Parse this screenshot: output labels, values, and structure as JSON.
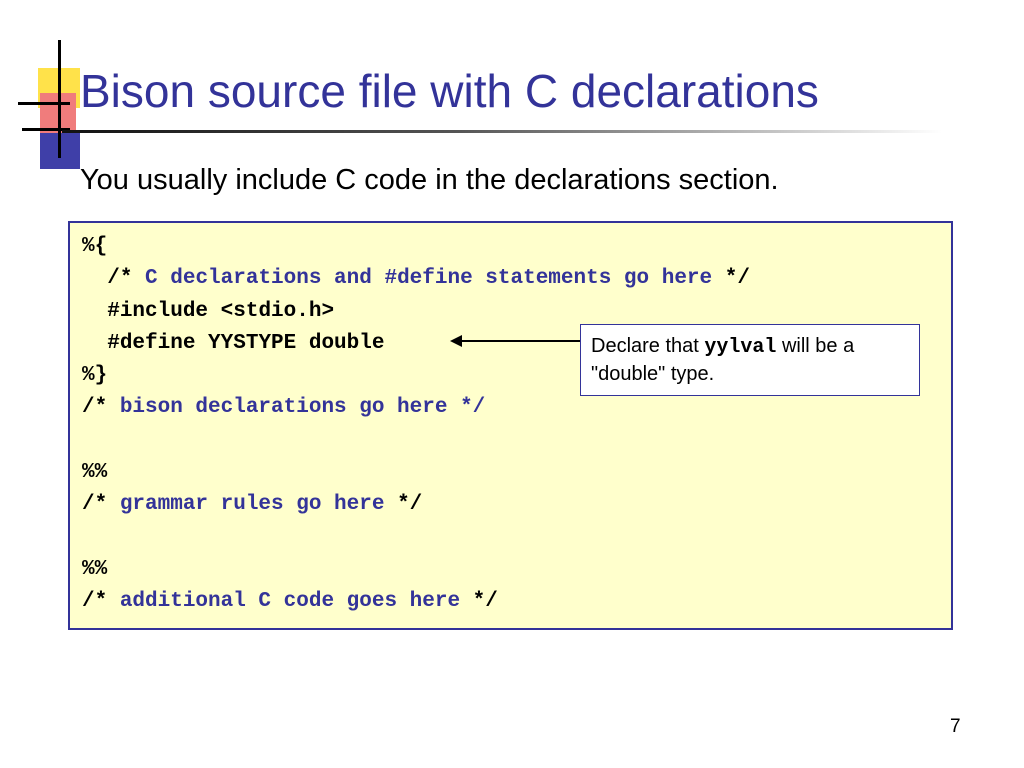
{
  "slide": {
    "title": "Bison source file with C declarations",
    "subtitle": "You usually include C code in the declarations section.",
    "page_number": "7"
  },
  "code": {
    "lines": [
      {
        "indent": "",
        "pre": "%{",
        "comment": "",
        "post": ""
      },
      {
        "indent": "  ",
        "pre": "/* ",
        "comment": "C declarations and #define statements go here ",
        "post": "*/"
      },
      {
        "indent": "  ",
        "pre": "#include <stdio.h>",
        "comment": "",
        "post": ""
      },
      {
        "indent": "  ",
        "pre": "#define YYSTYPE double",
        "comment": "",
        "post": ""
      },
      {
        "indent": "",
        "pre": "%}",
        "comment": "",
        "post": ""
      },
      {
        "indent": "",
        "pre": "/* ",
        "comment": "bison declarations go here */",
        "post": ""
      },
      {
        "indent": "",
        "pre": "",
        "comment": "",
        "post": ""
      },
      {
        "indent": "",
        "pre": "%%",
        "comment": "",
        "post": ""
      },
      {
        "indent": "",
        "pre": "/* ",
        "comment": "grammar rules go here ",
        "post": "*/"
      },
      {
        "indent": "",
        "pre": "",
        "comment": "",
        "post": ""
      },
      {
        "indent": "",
        "pre": "%%",
        "comment": "",
        "post": ""
      },
      {
        "indent": "",
        "pre": "/* ",
        "comment": "additional C code goes here ",
        "post": "*/"
      }
    ]
  },
  "callout": {
    "text_before": "Declare that ",
    "code": "yylval",
    "text_after": " will be a \"double\" type."
  },
  "colors": {
    "title": "#333399",
    "code_background": "#ffffcc",
    "comment": "#333399"
  }
}
